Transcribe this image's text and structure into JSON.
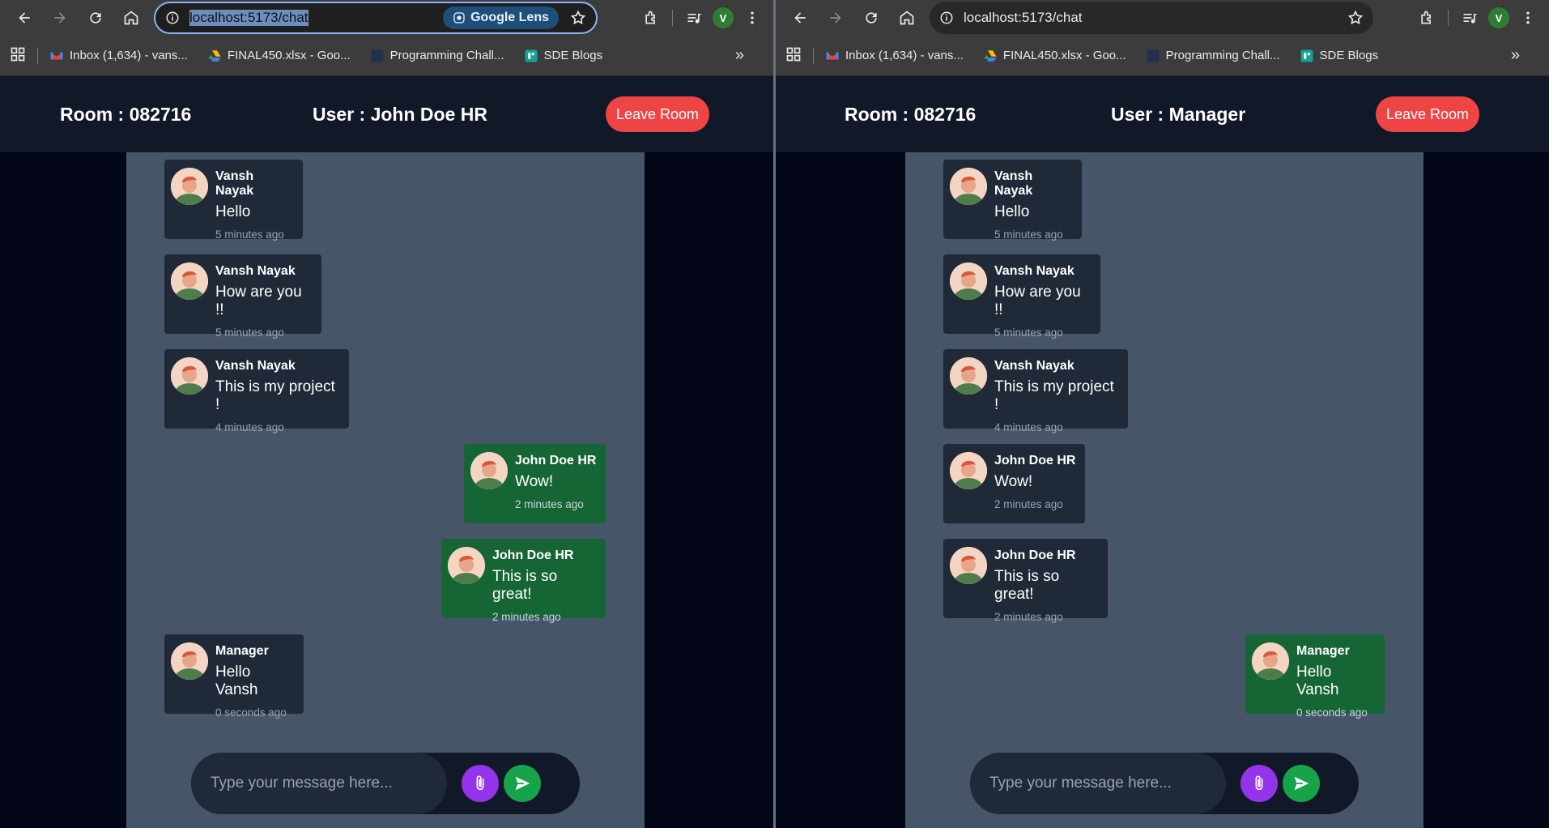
{
  "left": {
    "url": "localhost:5173/chat",
    "lens_label": "Google Lens",
    "bookmarks": [
      {
        "label": "Inbox (1,634) - vans..."
      },
      {
        "label": "FINAL450.xlsx - Goo..."
      },
      {
        "label": "Programming Chall..."
      },
      {
        "label": "SDE Blogs"
      }
    ],
    "profile_initial": "V",
    "room_label": "Room : 082716",
    "user_label": "User : John Doe HR",
    "leave_label": "Leave Room",
    "messages": [
      {
        "name": "Vansh Nayak",
        "text": "Hello",
        "time": "5 minutes ago"
      },
      {
        "name": "Vansh Nayak",
        "text": "How are you !!",
        "time": "5 minutes ago"
      },
      {
        "name": "Vansh Nayak",
        "text": "This is my project !",
        "time": "4 minutes ago"
      },
      {
        "name": "John Doe HR",
        "text": "Wow!",
        "time": "2 minutes ago"
      },
      {
        "name": "John Doe HR",
        "text": "This is so great!",
        "time": "2 minutes ago"
      },
      {
        "name": "Manager",
        "text": "Hello Vansh",
        "time": "0 seconds ago"
      }
    ],
    "placeholder": "Type your message here..."
  },
  "right": {
    "url": "localhost:5173/chat",
    "bookmarks": [
      {
        "label": "Inbox (1,634) - vans..."
      },
      {
        "label": "FINAL450.xlsx - Goo..."
      },
      {
        "label": "Programming Chall..."
      },
      {
        "label": "SDE Blogs"
      }
    ],
    "profile_initial": "V",
    "room_label": "Room : 082716",
    "user_label": "User : Manager",
    "leave_label": "Leave Room",
    "messages": [
      {
        "name": "Vansh Nayak",
        "text": "Hello",
        "time": "5 minutes ago"
      },
      {
        "name": "Vansh Nayak",
        "text": "How are you !!",
        "time": "5 minutes ago"
      },
      {
        "name": "Vansh Nayak",
        "text": "This is my project !",
        "time": "4 minutes ago"
      },
      {
        "name": "John Doe HR",
        "text": "Wow!",
        "time": "2 minutes ago"
      },
      {
        "name": "John Doe HR",
        "text": "This is so great!",
        "time": "2 minutes ago"
      },
      {
        "name": "Manager",
        "text": "Hello Vansh",
        "time": "0 seconds ago"
      }
    ],
    "placeholder": "Type your message here..."
  },
  "colors": {
    "header_bg": "#111827",
    "chat_bg": "#475569",
    "other_bubble": "#1f2937",
    "own_bubble": "#166534",
    "leave_button": "#ef4444",
    "attach_button": "#9333ea",
    "send_button": "#16a34a"
  }
}
